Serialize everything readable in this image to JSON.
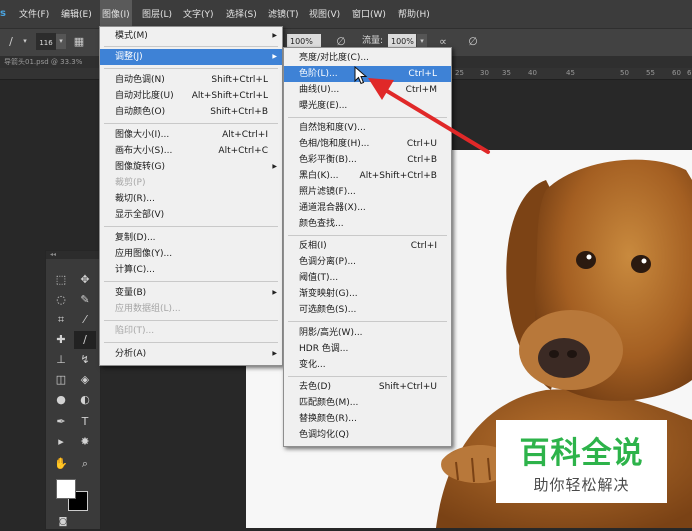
{
  "menubar": {
    "items": [
      "文件(F)",
      "编辑(E)",
      "图像(I)",
      "图层(L)",
      "文字(Y)",
      "选择(S)",
      "滤镜(T)",
      "视图(V)",
      "窗口(W)",
      "帮助(H)"
    ],
    "logo": "s"
  },
  "options_bar": {
    "brush_size": "116",
    "opacity": "100%",
    "flow_label": "流量:",
    "flow": "100%"
  },
  "document": {
    "tab_title": "导箭头01.psd @ 33.3%"
  },
  "ruler": {
    "ticks": [
      "25",
      "30",
      "35",
      "40",
      "45",
      "50",
      "55",
      "60",
      "65"
    ]
  },
  "image_menu": {
    "items": [
      {
        "label": "模式(M)",
        "shortcut": "",
        "submenu": true,
        "disabled": false
      },
      {
        "label": "调整(J)",
        "shortcut": "",
        "submenu": true,
        "disabled": false,
        "highlighted": true
      },
      {
        "label": "自动色调(N)",
        "shortcut": "Shift+Ctrl+L",
        "submenu": false,
        "disabled": false
      },
      {
        "label": "自动对比度(U)",
        "shortcut": "Alt+Shift+Ctrl+L",
        "submenu": false,
        "disabled": false
      },
      {
        "label": "自动颜色(O)",
        "shortcut": "Shift+Ctrl+B",
        "submenu": false,
        "disabled": false
      },
      {
        "label": "图像大小(I)...",
        "shortcut": "Alt+Ctrl+I",
        "submenu": false,
        "disabled": false
      },
      {
        "label": "画布大小(S)...",
        "shortcut": "Alt+Ctrl+C",
        "submenu": false,
        "disabled": false
      },
      {
        "label": "图像旋转(G)",
        "shortcut": "",
        "submenu": true,
        "disabled": false
      },
      {
        "label": "裁剪(P)",
        "shortcut": "",
        "submenu": false,
        "disabled": true
      },
      {
        "label": "裁切(R)...",
        "shortcut": "",
        "submenu": false,
        "disabled": false
      },
      {
        "label": "显示全部(V)",
        "shortcut": "",
        "submenu": false,
        "disabled": false
      },
      {
        "label": "复制(D)...",
        "shortcut": "",
        "submenu": false,
        "disabled": false
      },
      {
        "label": "应用图像(Y)...",
        "shortcut": "",
        "submenu": false,
        "disabled": false
      },
      {
        "label": "计算(C)...",
        "shortcut": "",
        "submenu": false,
        "disabled": false
      },
      {
        "label": "变量(B)",
        "shortcut": "",
        "submenu": true,
        "disabled": false
      },
      {
        "label": "应用数据组(L)...",
        "shortcut": "",
        "submenu": false,
        "disabled": true
      },
      {
        "label": "陷印(T)...",
        "shortcut": "",
        "submenu": false,
        "disabled": true
      },
      {
        "label": "分析(A)",
        "shortcut": "",
        "submenu": true,
        "disabled": false
      }
    ]
  },
  "adjust_menu": {
    "items": [
      {
        "label": "亮度/对比度(C)...",
        "shortcut": ""
      },
      {
        "label": "色阶(L)...",
        "shortcut": "Ctrl+L",
        "highlighted": true
      },
      {
        "label": "曲线(U)...",
        "shortcut": "Ctrl+M"
      },
      {
        "label": "曝光度(E)...",
        "shortcut": ""
      },
      {
        "label": "自然饱和度(V)...",
        "shortcut": ""
      },
      {
        "label": "色相/饱和度(H)...",
        "shortcut": "Ctrl+U"
      },
      {
        "label": "色彩平衡(B)...",
        "shortcut": "Ctrl+B"
      },
      {
        "label": "黑白(K)...",
        "shortcut": "Alt+Shift+Ctrl+B"
      },
      {
        "label": "照片滤镜(F)...",
        "shortcut": ""
      },
      {
        "label": "通道混合器(X)...",
        "shortcut": ""
      },
      {
        "label": "颜色查找...",
        "shortcut": ""
      },
      {
        "label": "反相(I)",
        "shortcut": "Ctrl+I"
      },
      {
        "label": "色调分离(P)...",
        "shortcut": ""
      },
      {
        "label": "阈值(T)...",
        "shortcut": ""
      },
      {
        "label": "渐变映射(G)...",
        "shortcut": ""
      },
      {
        "label": "可选颜色(S)...",
        "shortcut": ""
      },
      {
        "label": "阴影/高光(W)...",
        "shortcut": ""
      },
      {
        "label": "HDR 色调...",
        "shortcut": ""
      },
      {
        "label": "变化...",
        "shortcut": ""
      },
      {
        "label": "去色(D)",
        "shortcut": "Shift+Ctrl+U"
      },
      {
        "label": "匹配颜色(M)...",
        "shortcut": ""
      },
      {
        "label": "替换颜色(R)...",
        "shortcut": ""
      },
      {
        "label": "色调均化(Q)",
        "shortcut": ""
      }
    ]
  },
  "watermark": {
    "title": "百科全说",
    "subtitle": "助你轻松解决"
  },
  "colors": {
    "highlight": "#3e82d6",
    "arrow": "#e02828",
    "watermark_green": "#2db34a"
  }
}
